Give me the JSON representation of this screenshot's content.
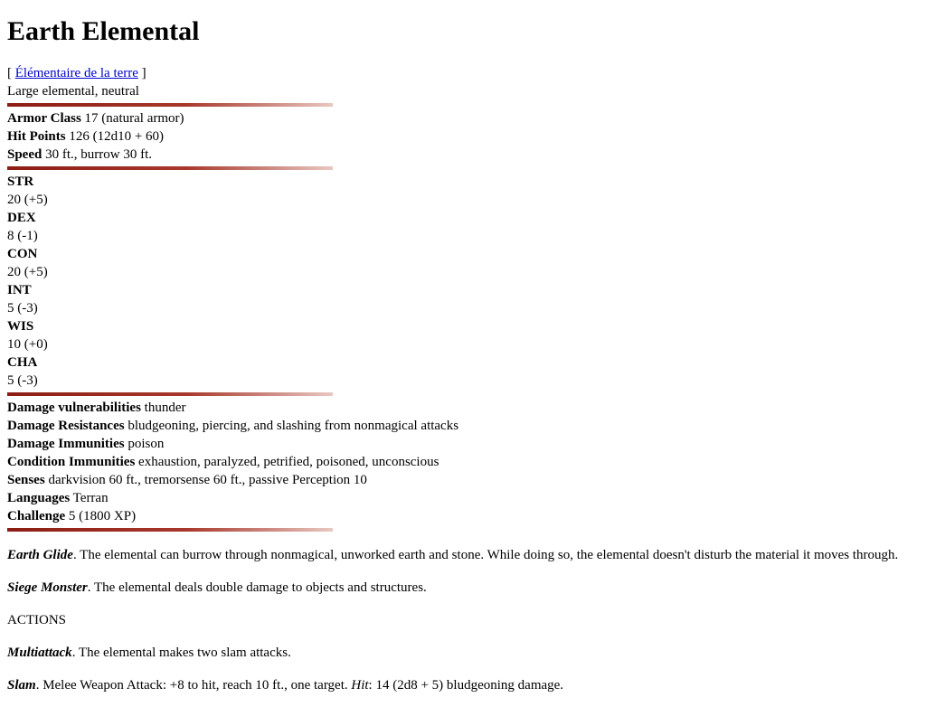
{
  "title": "Earth Elemental",
  "lang_link": {
    "open": "[ ",
    "label": "Élémentaire de la terre",
    "close": " ]"
  },
  "subtitle": "Large elemental, neutral",
  "defense": [
    {
      "label": "Armor Class",
      "value": " 17 (natural armor)"
    },
    {
      "label": "Hit Points",
      "value": " 126 (12d10 + 60)"
    },
    {
      "label": "Speed",
      "value": " 30 ft., burrow 30 ft."
    }
  ],
  "abilities": [
    {
      "name": "STR",
      "score": "20 (+5)"
    },
    {
      "name": "DEX",
      "score": "8 (-1)"
    },
    {
      "name": "CON",
      "score": "20 (+5)"
    },
    {
      "name": "INT",
      "score": "5 (-3)"
    },
    {
      "name": "WIS",
      "score": "10 (+0)"
    },
    {
      "name": "CHA",
      "score": "5 (-3)"
    }
  ],
  "traits": [
    {
      "label": "Damage vulnerabilities",
      "value": " thunder"
    },
    {
      "label": "Damage Resistances",
      "value": " bludgeoning, piercing, and slashing from nonmagical attacks"
    },
    {
      "label": "Damage Immunities",
      "value": " poison"
    },
    {
      "label": "Condition Immunities",
      "value": " exhaustion, paralyzed, petrified, poisoned, unconscious"
    },
    {
      "label": "Senses",
      "value": " darkvision 60 ft., tremorsense 60 ft., passive Perception 10"
    },
    {
      "label": "Languages",
      "value": " Terran"
    },
    {
      "label": "Challenge",
      "value": " 5 (1800 XP)"
    }
  ],
  "special": [
    {
      "name": "Earth Glide",
      "text": ". The elemental can burrow through nonmagical, unworked earth and stone. While doing so, the elemental doesn't disturb the material it moves through."
    },
    {
      "name": "Siege Monster",
      "text": ". The elemental deals double damage to objects and structures."
    }
  ],
  "actions_heading": "ACTIONS",
  "actions": {
    "multiattack": {
      "name": "Multiattack",
      "text": ". The elemental makes two slam attacks."
    },
    "slam": {
      "name": "Slam",
      "text": ". Melee Weapon Attack: +8 to hit, reach 10 ft., one target. ",
      "hit_label": "Hit",
      "hit_text": ": 14 (2d8 + 5) bludgeoning damage."
    }
  }
}
